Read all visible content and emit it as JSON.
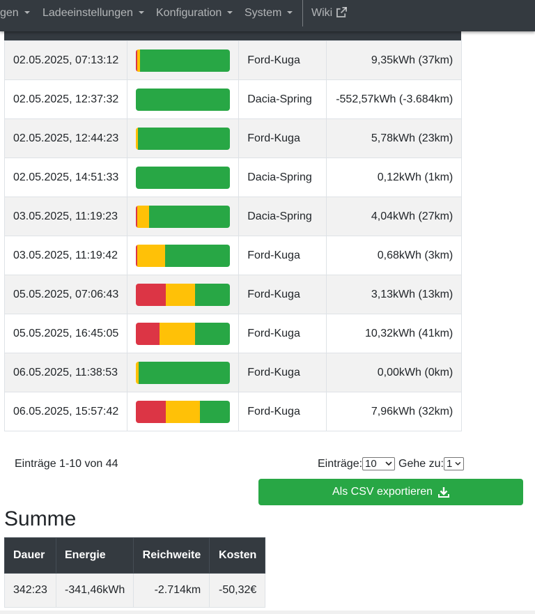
{
  "navbar": {
    "items": [
      "gen",
      "Ladeeinstellungen",
      "Konfiguration",
      "System"
    ],
    "wiki": "Wiki"
  },
  "log_rows": [
    {
      "date": "02.05.2025, 07:13:12",
      "soc": {
        "red": 1,
        "yellow": 3,
        "green": 96
      },
      "vehicle": "Ford-Kuga",
      "energy": "9,35kWh (37km)"
    },
    {
      "date": "02.05.2025, 12:37:32",
      "soc": {
        "red": 0,
        "yellow": 0,
        "green": 100
      },
      "vehicle": "Dacia-Spring",
      "energy": "-552,57kWh (-3.684km)"
    },
    {
      "date": "02.05.2025, 12:44:23",
      "soc": {
        "red": 0,
        "yellow": 2,
        "green": 98
      },
      "vehicle": "Ford-Kuga",
      "energy": "5,78kWh (23km)"
    },
    {
      "date": "02.05.2025, 14:51:33",
      "soc": {
        "red": 0,
        "yellow": 0,
        "green": 100
      },
      "vehicle": "Dacia-Spring",
      "energy": "0,12kWh (1km)"
    },
    {
      "date": "03.05.2025, 11:19:23",
      "soc": {
        "red": 1,
        "yellow": 13,
        "green": 86
      },
      "vehicle": "Dacia-Spring",
      "energy": "4,04kWh (27km)"
    },
    {
      "date": "03.05.2025, 11:19:42",
      "soc": {
        "red": 1,
        "yellow": 30,
        "green": 69
      },
      "vehicle": "Ford-Kuga",
      "energy": "0,68kWh (3km)"
    },
    {
      "date": "05.05.2025, 07:06:43",
      "soc": {
        "red": 32,
        "yellow": 31,
        "green": 37
      },
      "vehicle": "Ford-Kuga",
      "energy": "3,13kWh (13km)"
    },
    {
      "date": "05.05.2025, 16:45:05",
      "soc": {
        "red": 25,
        "yellow": 38,
        "green": 37
      },
      "vehicle": "Ford-Kuga",
      "energy": "10,32kWh (41km)"
    },
    {
      "date": "06.05.2025, 11:38:53",
      "soc": {
        "red": 0,
        "yellow": 3,
        "green": 97
      },
      "vehicle": "Ford-Kuga",
      "energy": "0,00kWh (0km)"
    },
    {
      "date": "06.05.2025, 15:57:42",
      "soc": {
        "red": 32,
        "yellow": 36,
        "green": 32
      },
      "vehicle": "Ford-Kuga",
      "energy": "7,96kWh (32km)"
    }
  ],
  "pagination": {
    "info": "Einträge 1-10 von 44",
    "entries_label": "Einträge:",
    "entries_value": "10",
    "goto_label": "Gehe zu:",
    "goto_value": "1"
  },
  "export_button": "Als CSV exportieren",
  "summary": {
    "title": "Summe",
    "headers": [
      "Dauer",
      "Energie",
      "Reichweite",
      "Kosten"
    ],
    "values": [
      "342:23",
      "-341,46kWh",
      "-2.714km",
      "-50,32€"
    ]
  },
  "colors": {
    "red": "#dc3545",
    "yellow": "#ffc107",
    "green": "#28a745",
    "navbar": "#343a40"
  }
}
